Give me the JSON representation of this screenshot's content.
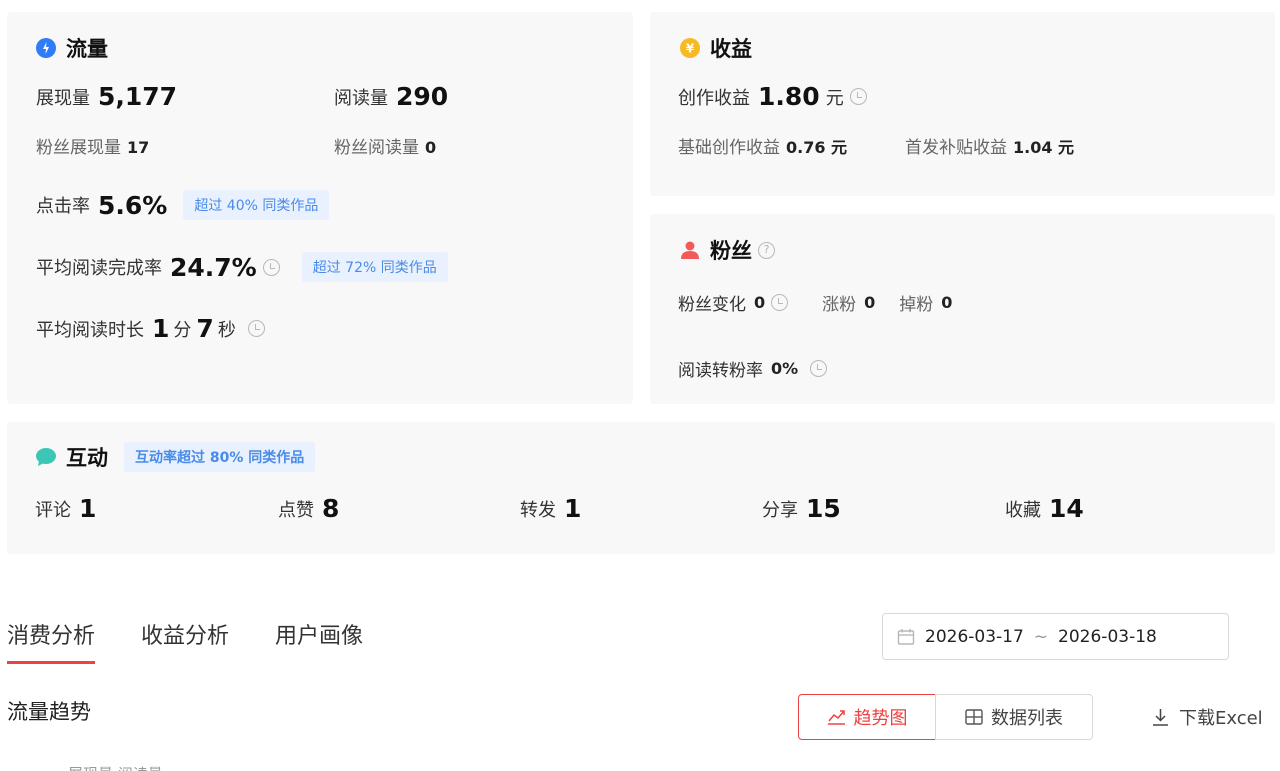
{
  "traffic": {
    "title": "流量",
    "impressions_label": "展现量",
    "impressions_value": "5,177",
    "reads_label": "阅读量",
    "reads_value": "290",
    "fan_impressions_label": "粉丝展现量",
    "fan_impressions_value": "17",
    "fan_reads_label": "粉丝阅读量",
    "fan_reads_value": "0",
    "ctr_label": "点击率",
    "ctr_value": "5.6%",
    "ctr_badge": "超过 40% 同类作品",
    "completion_label": "平均阅读完成率",
    "completion_value": "24.7%",
    "completion_badge": "超过 72% 同类作品",
    "duration_label": "平均阅读时长",
    "duration_min": "1",
    "duration_min_unit": "分",
    "duration_sec": "7",
    "duration_sec_unit": "秒"
  },
  "income": {
    "title": "收益",
    "creation_label": "创作收益",
    "creation_value": "1.80",
    "creation_unit": "元",
    "base_label": "基础创作收益",
    "base_value": "0.76 元",
    "subsidy_label": "首发补贴收益",
    "subsidy_value": "1.04 元"
  },
  "fans": {
    "title": "粉丝",
    "change_label": "粉丝变化",
    "change_value": "0",
    "gain_label": "涨粉",
    "gain_value": "0",
    "loss_label": "掉粉",
    "loss_value": "0",
    "conversion_label": "阅读转粉率",
    "conversion_value": "0%"
  },
  "interaction": {
    "title": "互动",
    "badge": "互动率超过 80% 同类作品",
    "metrics": [
      {
        "label": "评论",
        "value": "1"
      },
      {
        "label": "点赞",
        "value": "8"
      },
      {
        "label": "转发",
        "value": "1"
      },
      {
        "label": "分享",
        "value": "15"
      },
      {
        "label": "收藏",
        "value": "14"
      }
    ]
  },
  "tabs": [
    "消费分析",
    "收益分析",
    "用户画像"
  ],
  "date_range": {
    "start": "2026-03-17",
    "separator": "~",
    "end": "2026-03-18"
  },
  "trend": {
    "title": "流量趋势",
    "trend_button": "趋势图",
    "list_button": "数据列表",
    "download_label": "下载Excel",
    "legend_partial": "展现量  阅读量"
  },
  "colors": {
    "accent": "#f04142",
    "badge_bg": "#e8f1fd",
    "badge_text": "#4a8be8",
    "card_bg": "#f8f8f9"
  },
  "icons": {
    "traffic": "blue-drop-icon",
    "income": "yellow-coin-icon",
    "fans": "red-person-icon",
    "interaction": "teal-chat-icon"
  }
}
